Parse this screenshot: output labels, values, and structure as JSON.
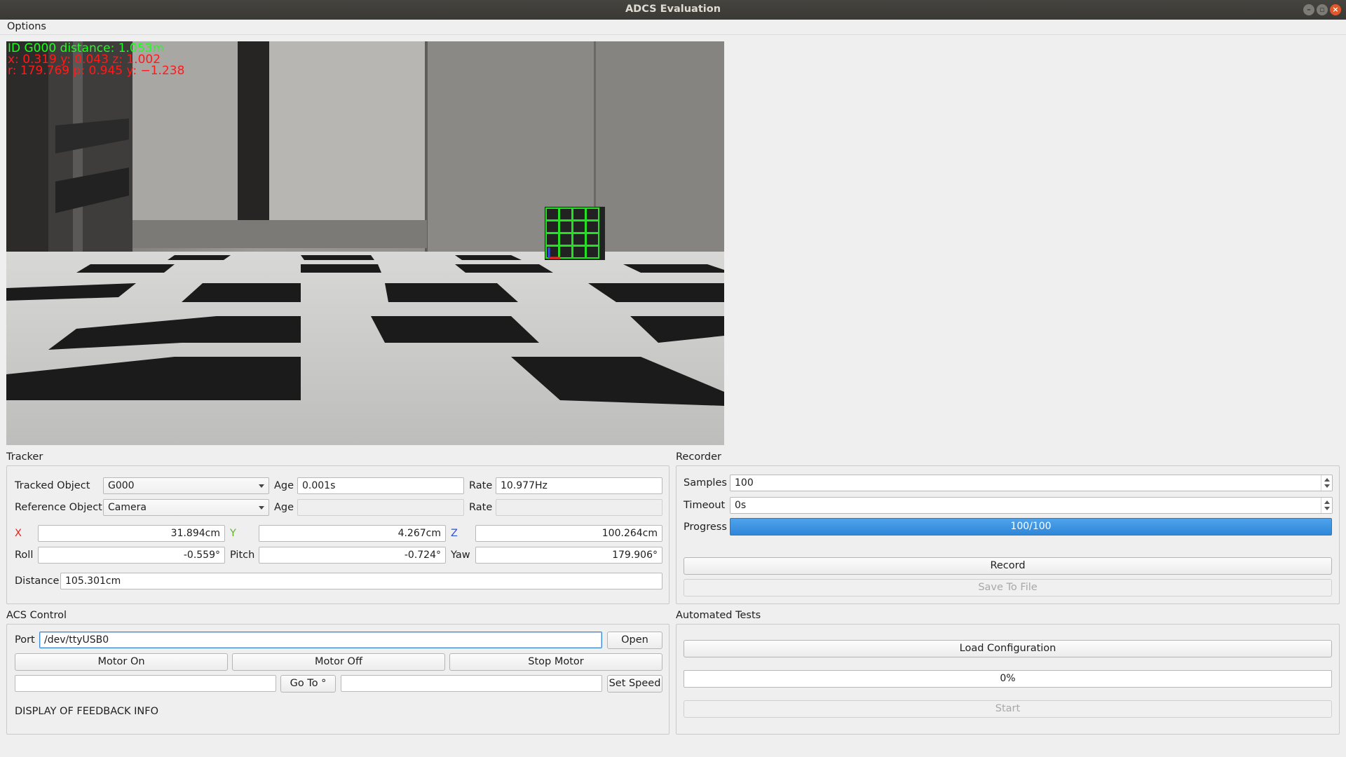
{
  "window": {
    "title": "ADCS Evaluation"
  },
  "menubar": {
    "options": "Options"
  },
  "camera": {
    "overlay_line1": "ID G000 distance: 1.053m",
    "overlay_line2": "x: 0.319 y: 0.043 z: 1.002",
    "overlay_line3": "r: 179.769 p: 0.945 y: −1.238"
  },
  "tracker": {
    "group_title": "Tracker",
    "tracked_object_label": "Tracked Object",
    "tracked_object_value": "G000",
    "reference_object_label": "Reference Object",
    "reference_object_value": "Camera",
    "age_label": "Age",
    "age_value": "0.001s",
    "age2_label": "Age",
    "age2_value": "",
    "rate_label": "Rate",
    "rate_value": "10.977Hz",
    "rate2_label": "Rate",
    "rate2_value": "",
    "x_label": "X",
    "x_value": "31.894cm",
    "y_label": "Y",
    "y_value": "4.267cm",
    "z_label": "Z",
    "z_value": "100.264cm",
    "roll_label": "Roll",
    "roll_value": "-0.559°",
    "pitch_label": "Pitch",
    "pitch_value": "-0.724°",
    "yaw_label": "Yaw",
    "yaw_value": "179.906°",
    "distance_label": "Distance",
    "distance_value": "105.301cm",
    "colors": {
      "x": "#e8231f",
      "y": "#5fb22a",
      "z": "#2d54d8"
    }
  },
  "recorder": {
    "group_title": "Recorder",
    "samples_label": "Samples",
    "samples_value": "100",
    "timeout_label": "Timeout",
    "timeout_value": "0s",
    "progress_label": "Progress",
    "progress_text": "100/100",
    "progress_fraction": 1.0,
    "record_button": "Record",
    "save_button": "Save To File"
  },
  "acs": {
    "group_title": "ACS Control",
    "port_label": "Port",
    "port_value": "/dev/ttyUSB0",
    "open_button": "Open",
    "motor_on_button": "Motor On",
    "motor_off_button": "Motor Off",
    "stop_motor_button": "Stop Motor",
    "goto_value": "",
    "goto_button": "Go To °",
    "speed_value": "",
    "set_speed_button": "Set Speed",
    "feedback_text": "DISPLAY OF FEEDBACK INFO"
  },
  "automated": {
    "group_title": "Automated Tests",
    "load_button": "Load Configuration",
    "progress_text": "0%",
    "progress_fraction": 0,
    "start_button": "Start"
  }
}
